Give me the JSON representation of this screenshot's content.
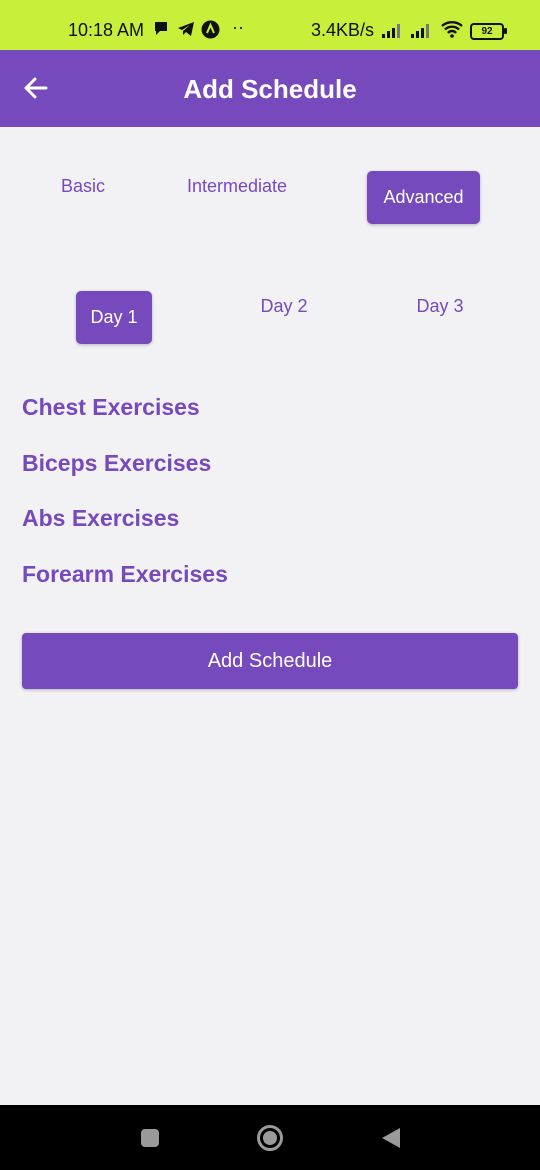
{
  "status_bar": {
    "time": "10:18 AM",
    "speed": "3.4KB/s",
    "battery": "92",
    "icons": [
      "chat-icon",
      "telegram-icon",
      "app-icon",
      "more-dots-icon",
      "signal-icon",
      "signal-icon",
      "wifi-icon",
      "battery-icon"
    ]
  },
  "app_bar": {
    "title": "Add Schedule",
    "back_icon": "arrow-left-icon"
  },
  "levels": {
    "basic": "Basic",
    "intermediate": "Intermediate",
    "advanced": "Advanced",
    "selected": "Advanced"
  },
  "days": {
    "day1": "Day 1",
    "day2": "Day 2",
    "day3": "Day 3",
    "selected": "Day 1"
  },
  "exercises": {
    "chest": "Chest Exercises",
    "biceps": "Biceps Exercises",
    "abs": "Abs Exercises",
    "forearm": "Forearm Exercises"
  },
  "add_button": "Add Schedule",
  "nav": [
    "recents-icon",
    "home-icon",
    "back-icon"
  ],
  "colors": {
    "primary": "#7649bd",
    "status_bar": "#c8f03a",
    "background": "#f2f2f4"
  }
}
